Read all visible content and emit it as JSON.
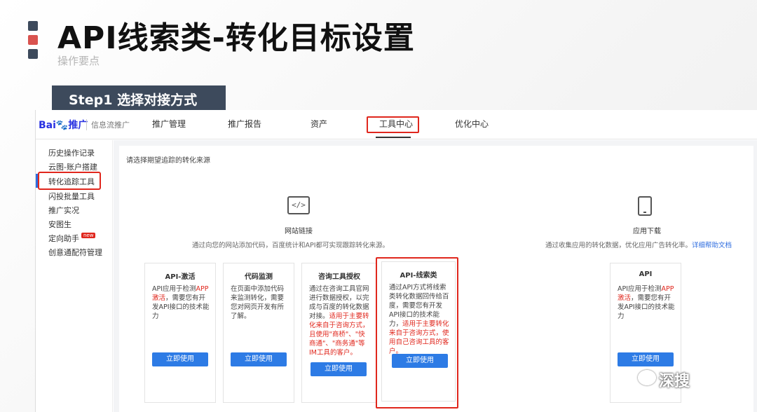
{
  "slide": {
    "title": "API线索类-转化目标设置",
    "subtitle": "操作要点",
    "step": "Step1 选择对接方式"
  },
  "topnav": {
    "logo": "Bai",
    "logo_paw": "🐾",
    "logo_tail": "推广",
    "product": "信息流推广",
    "items": [
      "推广管理",
      "推广报告",
      "资产",
      "工具中心",
      "优化中心"
    ],
    "active": "工具中心"
  },
  "sidebar": {
    "items": [
      "历史操作记录",
      "云图-账户搭建",
      "转化追踪工具",
      "闪投批量工具",
      "推广实况",
      "安图生",
      "定向助手",
      "创意通配符管理"
    ],
    "active": "转化追踪工具",
    "new_badge": "new"
  },
  "main": {
    "prompt": "请选择期望追踪的转化来源",
    "sources": [
      {
        "icon": "code-icon",
        "icon_glyph": "</>",
        "label": "网站链接",
        "desc": "通过向您的网站添加代码，百度统计和API都可实现跟踪转化来源。"
      },
      {
        "icon": "phone-icon",
        "label": "应用下载",
        "desc": "通过收集应用的转化数据，优化应用广告转化率。",
        "link": "详细帮助文档"
      }
    ],
    "cards": [
      {
        "title": "API-激活",
        "body_pre": "API应用于检测",
        "body_red": "APP激活",
        "body_post": "，需要您有开发API接口的技术能力",
        "button": "立即使用"
      },
      {
        "title": "代码监测",
        "body": "在页面中添加代码来监测转化，需要您对网页开发有所了解。",
        "button": "立即使用"
      },
      {
        "title": "咨询工具授权",
        "body": "通过在咨询工具官网进行数据授权，以完成与百度的转化数据对接。",
        "body_red": "适用于主要转化来自于咨询方式，且使用\"商桥\"、\"快商通\"、\"商务通\"等IM工具的客户。",
        "button": "立即使用"
      },
      {
        "title": "API-线索类",
        "body": "通过API方式将线索类转化数据回传给百度，需要您有开发API接口的技术能力，",
        "body_red": "适用于主要转化来自于咨询方式，使用自己咨询工具的客户。",
        "button": "立即使用"
      },
      {
        "title": "API",
        "body_pre": "API应用于检测",
        "body_red": "APP激活",
        "body_post": "，需要您有开发API接口的技术能力",
        "button": "立即使用"
      }
    ]
  },
  "watermark": {
    "text": "深搜"
  },
  "colors": {
    "accent_red": "#e0271d",
    "button_blue": "#2d7be5",
    "banner": "#3d4a5c"
  }
}
